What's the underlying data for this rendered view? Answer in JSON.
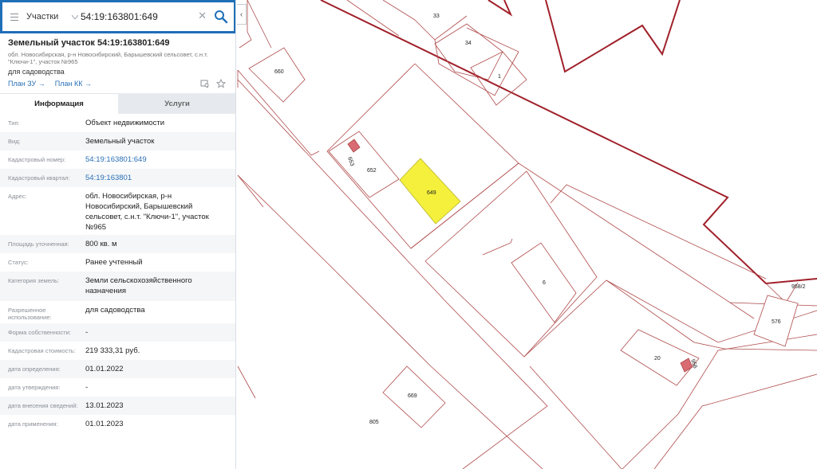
{
  "search": {
    "scope": "Участки",
    "value": "54:19:163801:649",
    "icons": {
      "menu": "menu-icon",
      "dropdown": "chevron-down-icon",
      "clear": "close-icon",
      "search": "search-icon"
    }
  },
  "object": {
    "title": "Земельный участок 54:19:163801:649",
    "address": "обл. Новосибирская, р-н Новосибирский, Барышевский сельсовет, с.н.т. \"Ключи-1\", участок №965",
    "use": "для садоводства",
    "plan_zu": "План ЗУ →",
    "plan_kk": "План КК →",
    "icons": [
      "layers-icon",
      "star-icon"
    ]
  },
  "tabs": [
    {
      "label": "Информация",
      "active": true
    },
    {
      "label": "Услуги",
      "active": false
    }
  ],
  "info": [
    {
      "label": "Тип:",
      "value": "Объект недвижимости",
      "link": false
    },
    {
      "label": "Вид:",
      "value": "Земельный участок",
      "link": false
    },
    {
      "label": "Кадастровый номер:",
      "value": "54:19:163801:649",
      "link": true
    },
    {
      "label": "Кадастровый квартал:",
      "value": "54:19:163801",
      "link": true
    },
    {
      "label": "Адрес:",
      "value": "обл. Новосибирская, р-н Новосибирский, Барышевский сельсовет, с.н.т. \"Ключи-1\", участок №965",
      "link": false
    },
    {
      "label": "Площадь уточненная:",
      "value": "800 кв. м",
      "link": false
    },
    {
      "label": "Статус:",
      "value": "Ранее учтенный",
      "link": false
    },
    {
      "label": "Категория земель:",
      "value": "Земли сельскохозяйственного назначения",
      "link": false
    },
    {
      "label": "Разрешенное использование:",
      "value": "для садоводства",
      "link": false
    },
    {
      "label": "Форма собственности:",
      "value": "-",
      "link": false
    },
    {
      "label": "Кадастровая стоимость:",
      "value": "219 333,31 руб.",
      "link": false
    },
    {
      "label": "дата определения:",
      "value": "01.01.2022",
      "link": false
    },
    {
      "label": "дата утверждения:",
      "value": "-",
      "link": false
    },
    {
      "label": "дата внесения сведений:",
      "value": "13.01.2023",
      "link": false
    },
    {
      "label": "дата применения:",
      "value": "01.01.2023",
      "link": false
    }
  ],
  "map": {
    "collapse_icon": "chevron-left-icon",
    "parcel_labels": [
      "33",
      "34",
      "1",
      "660",
      "653",
      "652",
      "649",
      "6",
      "958/2",
      "576",
      "20",
      "956",
      "669",
      "805"
    ],
    "colors": {
      "parcel_line": "#b04a4a",
      "quarter_line": "#a0202a",
      "selected_fill": "#f5f03c",
      "small_fill": "#d96b73",
      "accent": "#1f6fb8"
    }
  }
}
